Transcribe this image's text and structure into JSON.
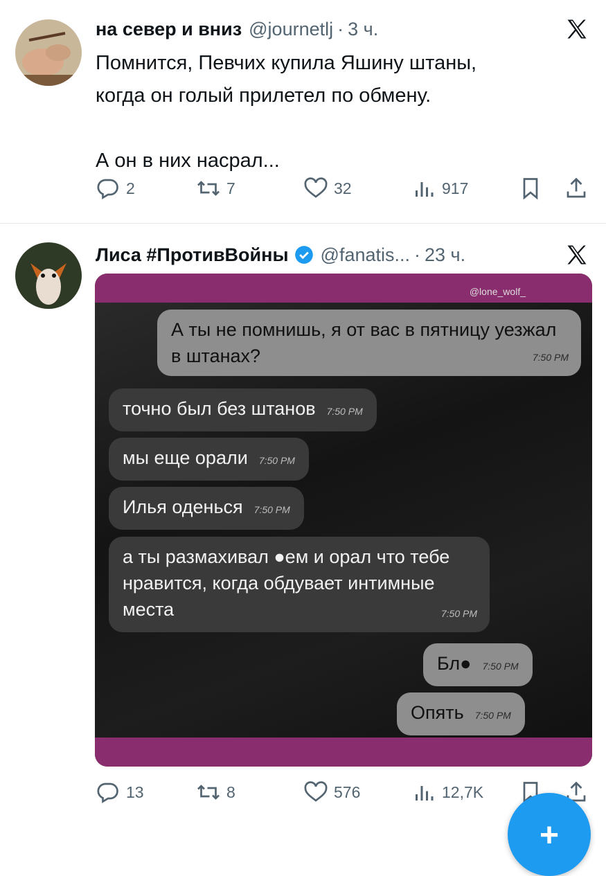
{
  "tweets": [
    {
      "name": "на север и вниз",
      "handle": "@journetlj",
      "time": "3 ч.",
      "text": [
        "Помнится, Певчих купила Яшину штаны,",
        "когда он голый прилетел по обмену.",
        "",
        "А он в них насрал..."
      ],
      "replies": "2",
      "retweets": "7",
      "likes": "32",
      "views": "917"
    },
    {
      "name": "Лиса #ПротивВойны",
      "handle": "@fanatis...",
      "time": "23 ч.",
      "replies": "13",
      "retweets": "8",
      "likes": "576",
      "views": "12,7K",
      "media": {
        "watermark": "@lone_wolf_",
        "messages": [
          {
            "text": "А ты не помнишь, я от вас в пятницу уезжал в штанах?",
            "time": "7:50 PM",
            "out": true
          },
          {
            "text": "точно был без штанов",
            "time": "7:50 PM",
            "out": false
          },
          {
            "text": "мы еще орали",
            "time": "7:50 PM",
            "out": false
          },
          {
            "text": "Илья оденься",
            "time": "7:50 PM",
            "out": false
          },
          {
            "text": "а ты размахивал ●ем и орал что тебе нравится, когда обдувает интимные места",
            "time": "7:50 PM",
            "out": false
          },
          {
            "text": "Бл●",
            "time": "7:50 PM",
            "out": true
          },
          {
            "text": "Опять",
            "time": "7:50 PM",
            "out": true
          }
        ]
      }
    }
  ],
  "colors": {
    "accent": "#1d9bf0",
    "muted": "#536471",
    "band": "#8a2d6e"
  },
  "icons": [
    "x-logo-icon",
    "reply-icon",
    "retweet-icon",
    "like-icon",
    "views-icon",
    "bookmark-icon",
    "share-icon",
    "verified-icon",
    "compose-plus-icon"
  ]
}
